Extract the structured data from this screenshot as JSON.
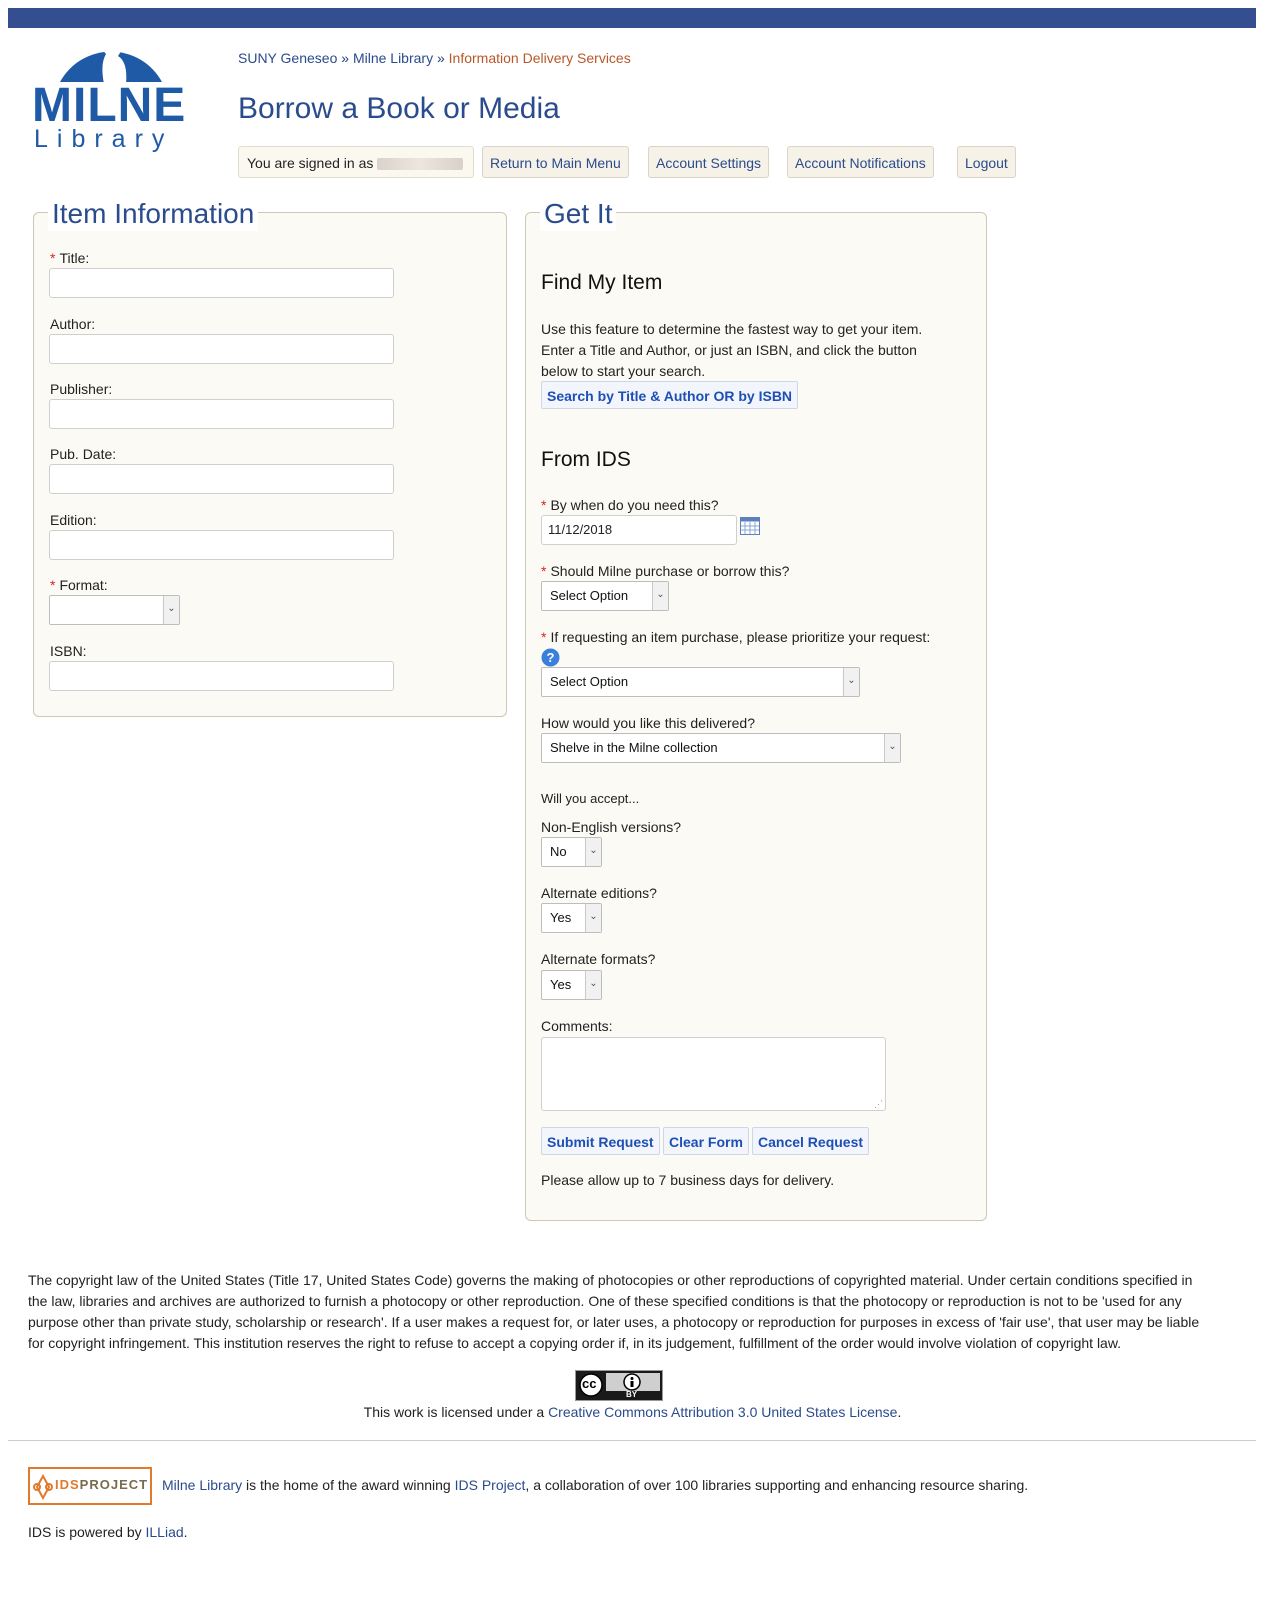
{
  "header": {
    "breadcrumb": [
      "SUNY Geneseo",
      "Milne Library",
      "Information Delivery Services"
    ],
    "breadcrumb_sep": "»",
    "page_title": "Borrow a Book or Media",
    "signed_in_label": "You are signed in as",
    "logo_word": "MILNE",
    "logo_sub": "Library",
    "nav": [
      "Return to Main Menu",
      "Account Settings",
      "Account Notifications",
      "Logout"
    ]
  },
  "item_info": {
    "legend": "Item Information",
    "fields": {
      "title": "Title:",
      "author": "Author:",
      "publisher": "Publisher:",
      "pub_date": "Pub. Date:",
      "edition": "Edition:",
      "format": "Format:",
      "isbn": "ISBN:"
    },
    "format_value": ""
  },
  "get_it": {
    "legend": "Get It",
    "find_heading": "Find My Item",
    "find_text_1": "Use this feature to determine the fastest way to get your item.",
    "find_text_2": "Enter a Title and Author, or just an ISBN, and click the button",
    "find_text_3": "below to start your search.",
    "search_button": "Search by Title & Author OR by ISBN",
    "ids_heading": "From IDS",
    "need_by_label": "By when do you need this?",
    "need_by_value": "11/12/2018",
    "purchase_label": "Should Milne purchase or borrow this?",
    "purchase_value": "Select Option",
    "priority_label": "If requesting an item purchase, please prioritize your request:",
    "priority_value": "Select Option",
    "delivery_label": "How would you like this delivered?",
    "delivery_value": "Shelve in the Milne collection",
    "accept_label": "Will you accept...",
    "non_english_label": "Non-English versions?",
    "non_english_value": "No",
    "alt_editions_label": "Alternate editions?",
    "alt_editions_value": "Yes",
    "alt_formats_label": "Alternate formats?",
    "alt_formats_value": "Yes",
    "comments_label": "Comments:",
    "buttons": [
      "Submit Request",
      "Clear Form",
      "Cancel Request"
    ],
    "delivery_note": "Please allow up to 7 business days for delivery."
  },
  "footer": {
    "copyright": "The copyright law of the United States (Title 17, United States Code) governs the making of photocopies or other reproductions of copyrighted material. Under certain conditions specified in the law, libraries and archives are authorized to furnish a photocopy or other reproduction. One of these specified conditions is that the photocopy or reproduction is not to be 'used for any purpose other than private study, scholarship or research'. If a user makes a request for, or later uses, a photocopy or reproduction for purposes in excess of 'fair use', that user may be liable for copyright infringement. This institution reserves the right to refuse to accept a copying order if, in its judgement, fulfillment of the order would involve violation of copyright law.",
    "license_prefix": "This work is licensed under a",
    "license_link": "Creative Commons Attribution 3.0 United States License",
    "license_suffix": ".",
    "cc_badge": "cc",
    "cc_by": "BY",
    "ids_logo_a": "IDS",
    "ids_logo_b": "PROJECT",
    "ids_link_1": "Milne Library",
    "ids_text_1": "is the home of the award winning",
    "ids_link_2": "IDS Project",
    "ids_text_2": ", a collaboration of over 100 libraries supporting and enhancing resource sharing.",
    "powered_prefix": "IDS is powered by",
    "powered_link": "ILLiad",
    "powered_suffix": "."
  },
  "colors": {
    "brand": "#334f8f",
    "accent": "#b8582a",
    "link": "#2a4b8c"
  }
}
